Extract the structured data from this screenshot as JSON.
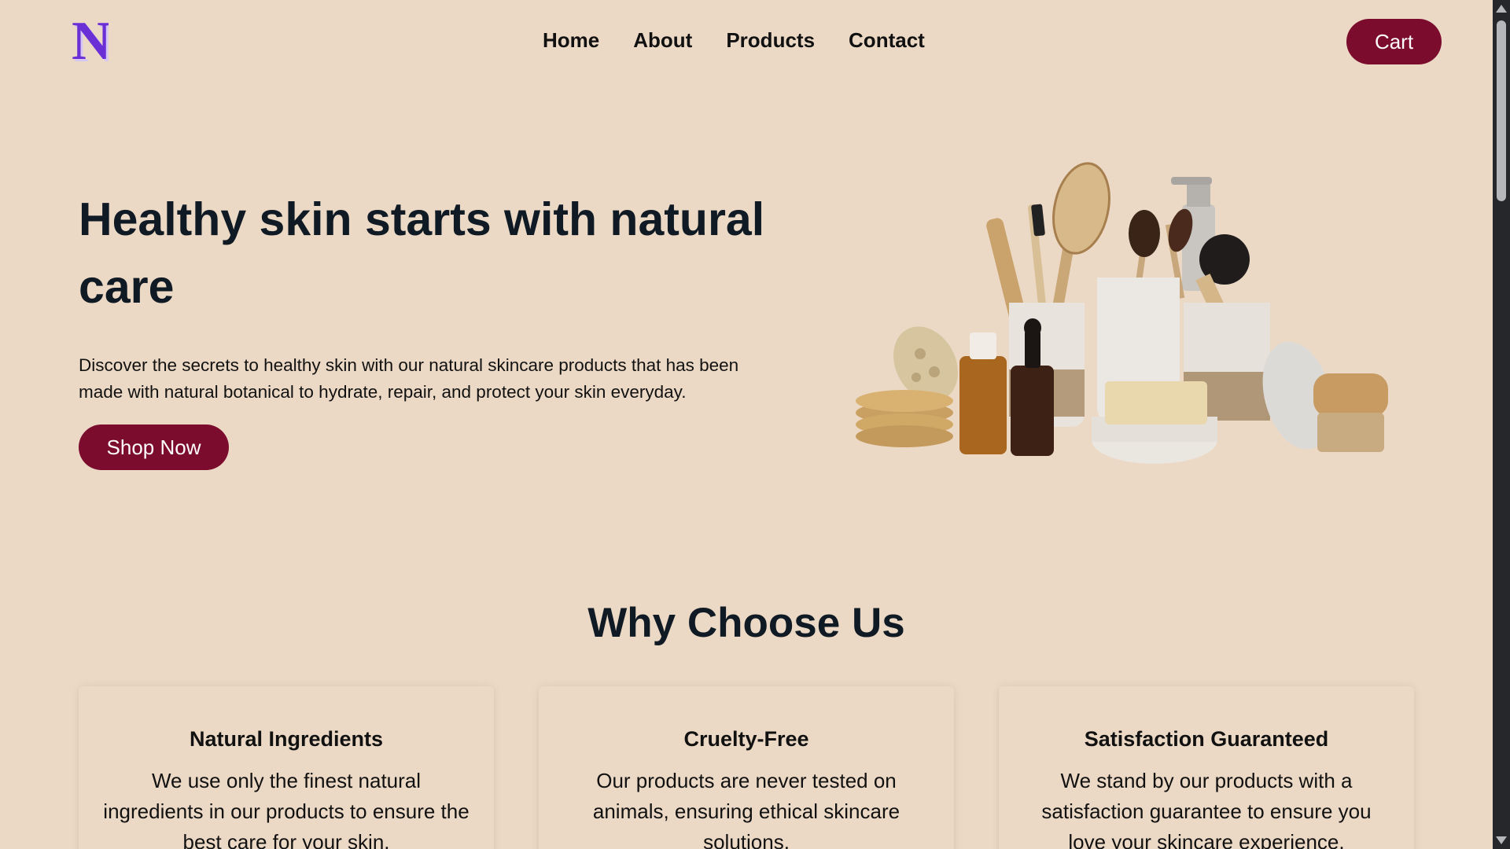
{
  "header": {
    "logo_letter": "N",
    "nav": [
      "Home",
      "About",
      "Products",
      "Contact"
    ],
    "cart_label": "Cart"
  },
  "hero": {
    "title": "Healthy skin starts with natural care",
    "description": "Discover the secrets to healthy skin with our natural skincare products that has been made with natural botanical to hydrate, repair, and protect your skin everyday.",
    "cta_label": "Shop Now"
  },
  "features": {
    "title": "Why Choose Us",
    "cards": [
      {
        "title": "Natural Ingredients",
        "text": "We use only the finest natural ingredients in our products to ensure the best care for your skin."
      },
      {
        "title": "Cruelty-Free",
        "text": "Our products are never tested on animals, ensuring ethical skincare solutions."
      },
      {
        "title": "Satisfaction Guaranteed",
        "text": "We stand by our products with a satisfaction guarantee to ensure you love your skincare experience."
      }
    ]
  },
  "colors": {
    "background": "#ecd9c5",
    "accent": "#7b0c2e",
    "heading": "#0f1a24",
    "logo": "#6b2fd6"
  }
}
